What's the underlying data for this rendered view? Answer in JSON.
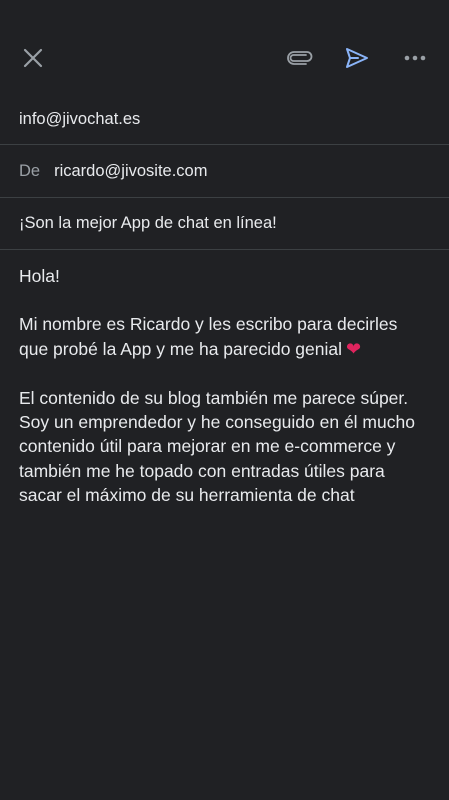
{
  "toolbar": {
    "close_icon": "close-icon",
    "attach_icon": "paperclip-icon",
    "send_icon": "send-icon",
    "more_icon": "more-horizontal-icon",
    "send_color": "#8ab4f8"
  },
  "compose": {
    "to": "info@jivochat.es",
    "from_label": "De",
    "from": "ricardo@jivosite.com",
    "subject": "¡Son la mejor App de chat en línea!",
    "body": {
      "greeting": "Hola!",
      "paragraph1": "Mi nombre es Ricardo y les escribo para decirles que probé la App y me ha parecido genial",
      "heart": "❤",
      "paragraph2": "El contenido de su blog también me parece súper. Soy un emprendedor y he conseguido en él mucho contenido útil para mejorar en me e-commerce y también me he topado con entradas útiles para sacar el máximo de su herramienta de chat"
    }
  },
  "colors": {
    "background": "#202124",
    "text": "#e8eaed",
    "muted": "#9aa0a6",
    "divider": "#3c4043",
    "heart": "#e0245e"
  }
}
